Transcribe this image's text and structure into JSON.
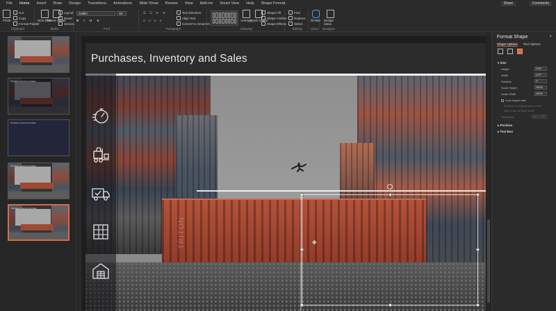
{
  "menu": {
    "tabs": [
      "File",
      "Home",
      "Insert",
      "Draw",
      "Design",
      "Transitions",
      "Animations",
      "Slide Show",
      "Review",
      "View",
      "Add-ins",
      "Smart View",
      "Help",
      "Shape Format"
    ],
    "active_tab": "Home",
    "share": "Share",
    "comments": "Comments"
  },
  "ribbon": {
    "clipboard": {
      "paste": "Paste",
      "cut": "Cut",
      "copy": "Copy",
      "format_painter": "Format Painter",
      "label": "Clipboard"
    },
    "slides": {
      "new_slide": "New Slide",
      "reuse": "Reuse Slides",
      "layout": "Layout",
      "reset": "Reset",
      "section": "Section",
      "label": "Slides"
    },
    "font": {
      "name": "Calibri",
      "size": "18",
      "label": "Font"
    },
    "paragraph": {
      "text_direction": "Text Direction",
      "align_text": "Align Text",
      "convert": "Convert to SmartArt",
      "label": "Paragraph"
    },
    "drawing": {
      "arrange": "Arrange",
      "quick_styles": "Quick Styles",
      "fill": "Shape Fill",
      "outline": "Shape Outline",
      "effects": "Shape Effects",
      "label": "Drawing"
    },
    "editing": {
      "find": "Find",
      "replace": "Replace",
      "select": "Select",
      "label": "Editing"
    },
    "voice": {
      "dictate": "Dictate",
      "label": "Voice"
    },
    "designer": {
      "design_ideas": "Design Ideas",
      "label": "Designer"
    }
  },
  "thumbnails": [
    {
      "num": "1",
      "title": "",
      "dark": false
    },
    {
      "num": "2",
      "title": "Purchases, Inventory and Sales",
      "dark": true
    },
    {
      "num": "3",
      "title": "Purchases, Inventory and Sales",
      "dark": true
    },
    {
      "num": "4",
      "title": "Purchases, Inventory and Sales",
      "dark": false
    },
    {
      "num": "5",
      "title": "Purchases, Inventory and Sales",
      "dark": false
    }
  ],
  "slide": {
    "title": "Purchases, Inventory and Sales",
    "container_brand": "TRITON",
    "icons": [
      "stopwatch-icon",
      "forklift-icon",
      "delivery-truck-icon",
      "pallet-shelf-icon",
      "warehouse-icon"
    ]
  },
  "pane": {
    "title": "Format Shape",
    "close": "×",
    "tab_shape": "Shape Options",
    "tab_text": "Text Options",
    "size_section": "Size",
    "height_label": "Height",
    "height_value": "2.62\"",
    "width_label": "Width",
    "width_value": "4.37\"",
    "rotation_label": "Rotation",
    "rotation_value": "0°",
    "scale_height_label": "Scale Height",
    "scale_height_value": "100%",
    "scale_width_label": "Scale Width",
    "scale_width_value": "100%",
    "lock_aspect": "Lock aspect ratio",
    "relative_original": "Relative to original picture size",
    "best_scale": "Best scale for slide show",
    "resolution_label": "Resolution",
    "resolution_value": "640 x 480",
    "position_section": "Position",
    "textbox_section": "Text Box"
  },
  "colors": {
    "accent": "#d86b4b",
    "background": "#1f1f1f"
  }
}
